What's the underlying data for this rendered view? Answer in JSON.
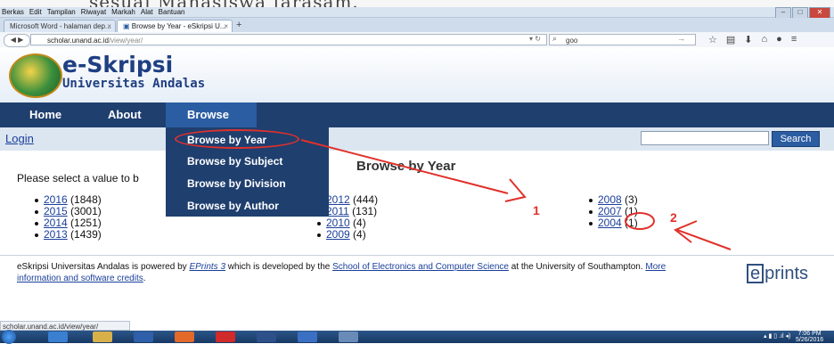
{
  "background_doc": {
    "text": "sesuai Mahasiswa farasam."
  },
  "menubar": {
    "items": [
      "Berkas",
      "Edit",
      "Tampilan",
      "Riwayat",
      "Markah",
      "Alat",
      "Bantuan"
    ]
  },
  "tabs": [
    {
      "label": "Microsoft Word - halaman dep..."
    },
    {
      "label": "Browse by Year - eSkripsi U..."
    }
  ],
  "address": {
    "host": "scholar.unand.ac.id",
    "path": "/view/year/"
  },
  "search": {
    "value": "goo"
  },
  "site": {
    "title": "e-Skripsi",
    "subtitle": "Universitas Andalas"
  },
  "mainmenu": {
    "home": "Home",
    "about": "About",
    "browse": "Browse"
  },
  "login": "Login",
  "search_button": "Search",
  "dropdown": {
    "items": [
      "Browse by Year",
      "Browse by Subject",
      "Browse by Division",
      "Browse by Author"
    ]
  },
  "content": {
    "title": "Browse by Year",
    "prompt": "Please select a value to b",
    "col1": [
      {
        "year": "2016",
        "count": "(1848)"
      },
      {
        "year": "2015",
        "count": "(3001)"
      },
      {
        "year": "2014",
        "count": "(1251)"
      },
      {
        "year": "2013",
        "count": "(1439)"
      }
    ],
    "col2": [
      {
        "year": "2012",
        "count": "(444)"
      },
      {
        "year": "2011",
        "count": "(131)"
      },
      {
        "year": "2010",
        "count": "(4)"
      },
      {
        "year": "2009",
        "count": "(4)"
      }
    ],
    "col3": [
      {
        "year": "2008",
        "count": "(3)"
      },
      {
        "year": "2007",
        "count": "(1)"
      },
      {
        "year": "2004",
        "count": "(1)"
      }
    ]
  },
  "annotations": {
    "label1": "1",
    "label2": "2",
    "color": "#e0312b"
  },
  "footer": {
    "t1": "eSkripsi Universitas Andalas is powered by ",
    "l1": "EPrints 3",
    "t2": " which is developed by the ",
    "l2": "School of Electronics and Computer Science",
    "t3": " at the University of Southampton. ",
    "l3": "More information and software credits",
    "t4": "."
  },
  "eprints_logo": {
    "e": "e",
    "rest": "prints"
  },
  "status": "scholar.unand.ac.id/view/year/",
  "clock": {
    "time": "7:06 PM",
    "date": "5/26/2016"
  }
}
